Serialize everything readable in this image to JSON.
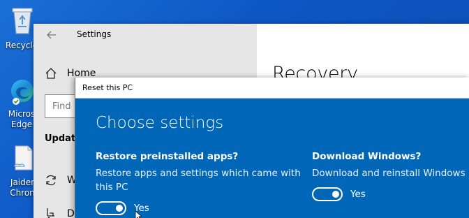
{
  "desktop": {
    "icons": [
      {
        "label": "Recycle",
        "icon": "recycle-bin-icon"
      },
      {
        "label_line1": "Micros",
        "label_line2": "Edge",
        "icon": "edge-icon"
      },
      {
        "label_line1": "Jaider",
        "label_line2": "Chron",
        "icon": "document-icon"
      }
    ]
  },
  "settings": {
    "title": "Settings",
    "nav": {
      "home_label": "Home",
      "search_placeholder": "Find",
      "section_heading": "Update",
      "items": [
        {
          "label": "W",
          "icon": "sync-icon"
        },
        {
          "label": "De",
          "icon": "delivery-icon"
        }
      ]
    },
    "page_heading": "Recovery"
  },
  "reset_dialog": {
    "title": "Reset this PC",
    "heading": "Choose settings",
    "options": [
      {
        "title": "Restore preinstalled apps?",
        "description_line1": "Restore apps and settings which came with",
        "description_line2": "this PC",
        "toggle_label": "Yes",
        "on": true
      },
      {
        "title": "Download Windows?",
        "description_line1": "Download and reinstall Windows",
        "toggle_label": "Yes",
        "on": true
      }
    ]
  }
}
